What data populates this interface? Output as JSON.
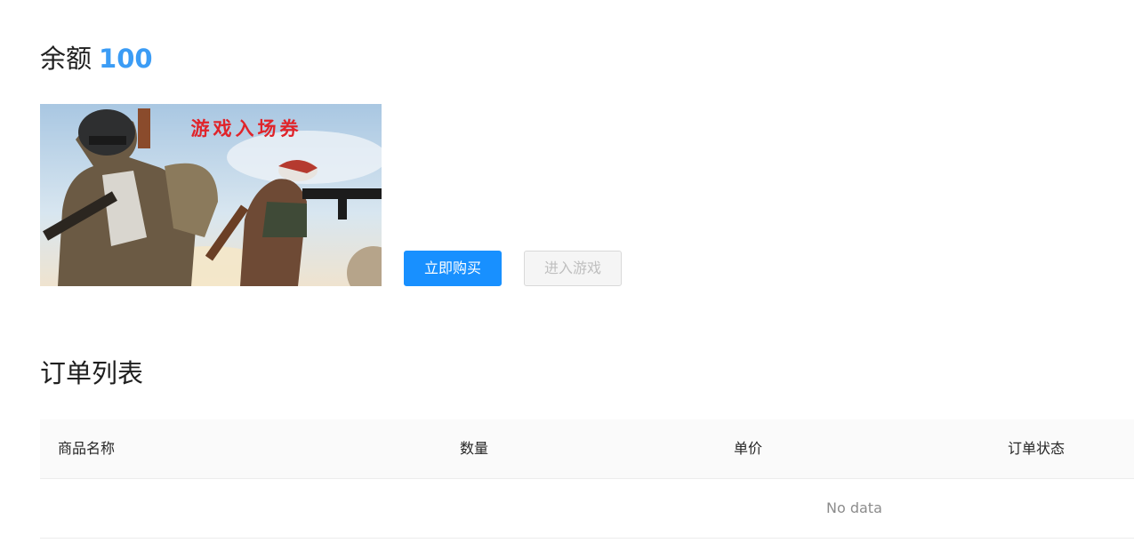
{
  "wallet": {
    "balance_label": "余额",
    "balance_value": "100"
  },
  "product": {
    "banner_text": "游戏入场券"
  },
  "actions": {
    "buy_label": "立即购买",
    "enter_label": "进入游戏"
  },
  "orders": {
    "title": "订单列表",
    "columns": [
      "商品名称",
      "数量",
      "单价",
      "订单状态"
    ],
    "empty_text": "No data"
  },
  "colors": {
    "accent": "#1890ff",
    "balance": "#3b9cf5",
    "banner_text": "#e0242a"
  }
}
